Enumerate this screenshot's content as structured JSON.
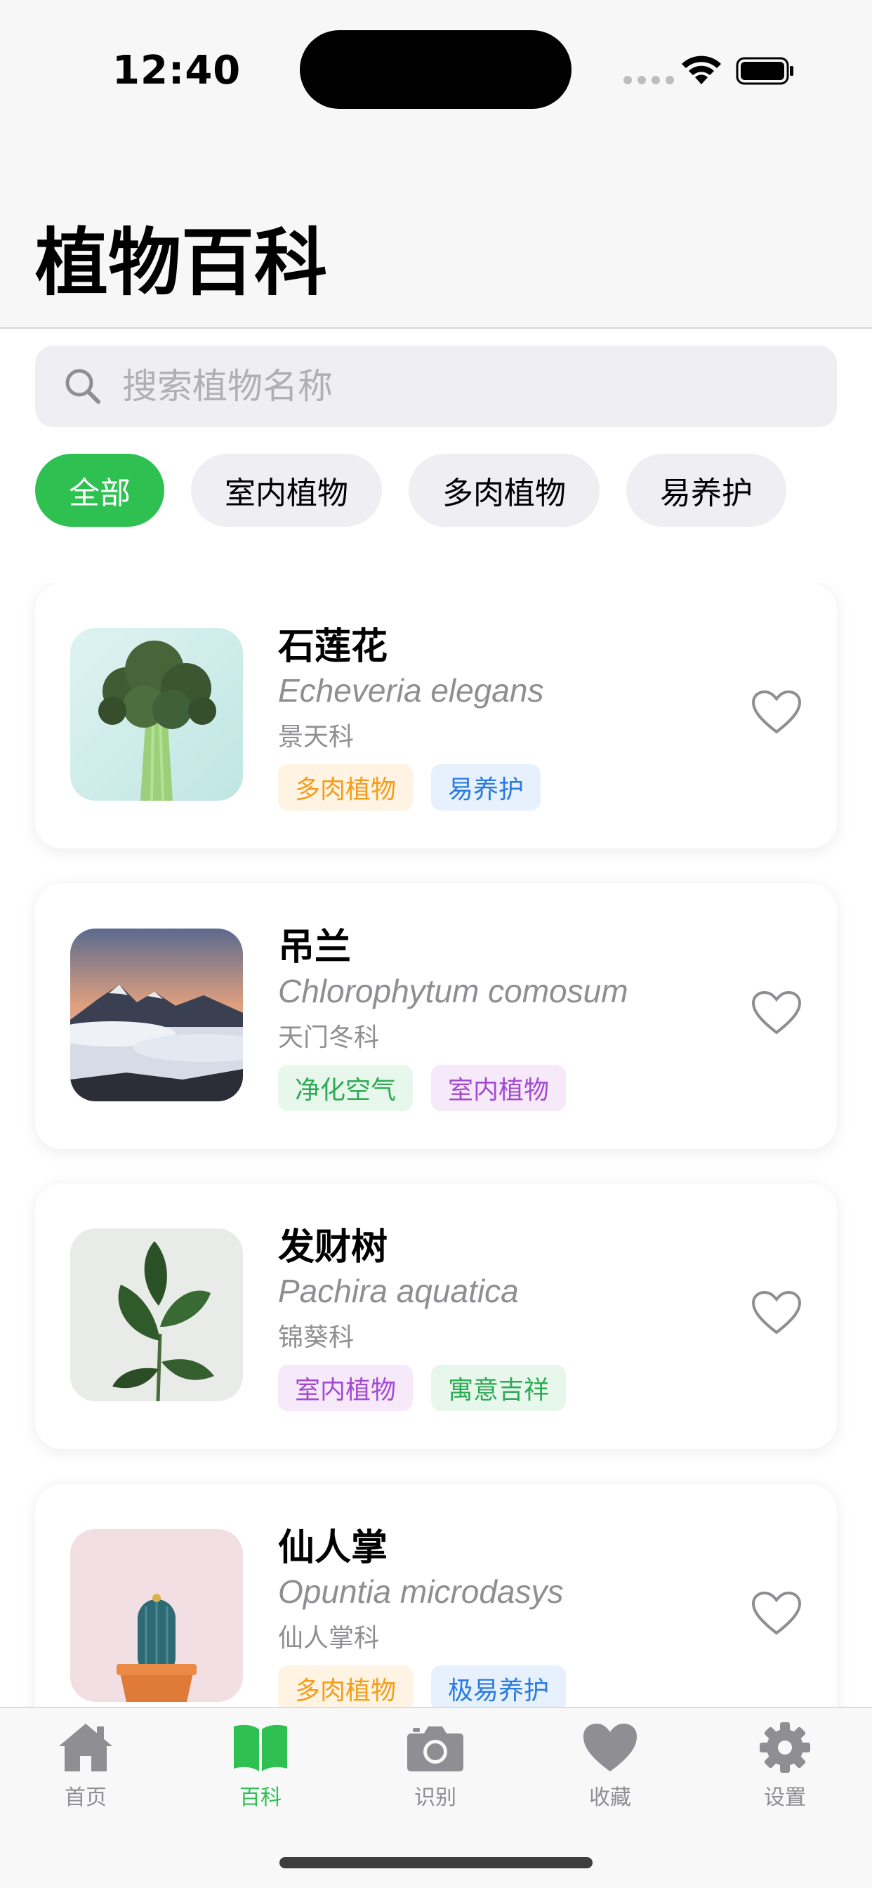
{
  "status": {
    "time": "12:40"
  },
  "header": {
    "title": "植物百科"
  },
  "search": {
    "placeholder": "搜索植物名称",
    "value": ""
  },
  "chips": [
    {
      "label": "全部",
      "active": true
    },
    {
      "label": "室内植物",
      "active": false
    },
    {
      "label": "多肉植物",
      "active": false
    },
    {
      "label": "易养护",
      "active": false
    }
  ],
  "plants": [
    {
      "name": "石莲花",
      "latin": "Echeveria elegans",
      "family": "景天科",
      "tags": [
        "多肉植物",
        "易养护"
      ],
      "image": "broccoli-photo"
    },
    {
      "name": "吊兰",
      "latin": "Chlorophytum comosum",
      "family": "天门冬科",
      "tags": [
        "净化空气",
        "室内植物"
      ],
      "image": "mountain-photo"
    },
    {
      "name": "发财树",
      "latin": "Pachira aquatica",
      "family": "锦葵科",
      "tags": [
        "室内植物",
        "寓意吉祥"
      ],
      "image": "leaf-photo"
    },
    {
      "name": "仙人掌",
      "latin": "Opuntia microdasys",
      "family": "仙人掌科",
      "tags": [
        "多肉植物",
        "极易养护"
      ],
      "image": "cactus-photo"
    }
  ],
  "tabs": [
    {
      "label": "首页",
      "icon": "house-icon",
      "active": false
    },
    {
      "label": "百科",
      "icon": "book-icon",
      "active": true
    },
    {
      "label": "识别",
      "icon": "camera-icon",
      "active": false
    },
    {
      "label": "收藏",
      "icon": "heart-icon",
      "active": false
    },
    {
      "label": "设置",
      "icon": "gear-icon",
      "active": false
    }
  ],
  "colors": {
    "accent": "#2ec152",
    "muted": "#8e8e93",
    "chipBg": "#efeff3"
  }
}
